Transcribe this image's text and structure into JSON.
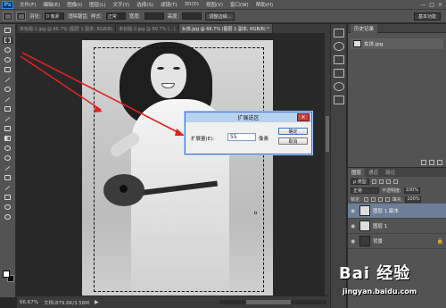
{
  "app": {
    "logo": "Ps"
  },
  "menu": [
    "文件(F)",
    "编辑(E)",
    "图像(I)",
    "图层(L)",
    "文字(Y)",
    "选择(S)",
    "滤镜(T)",
    "3D(D)",
    "视图(V)",
    "窗口(W)",
    "帮助(H)"
  ],
  "window_controls": [
    "—",
    "□",
    "×"
  ],
  "options": {
    "feather_label": "羽化:",
    "feather_value": "0 像素",
    "antialias": "消除锯齿",
    "style_label": "样式:",
    "style_value": "正常",
    "width_label": "宽度:",
    "height_label": "高度:",
    "refine_edge": "调整边缘...",
    "workspace": "基本功能"
  },
  "tabs": [
    "未标题-1.jpg @ 66.7% (图层 1 副本, RGB/8)",
    "未标题-2.jpg @ 66.7% (...)",
    "女孩.jpg @ 66.7% (图层 1 副本, RGB/8) *"
  ],
  "status": {
    "zoom": "66.67%",
    "doc": "文档:879.6K/3.58M",
    "arrow": "▶"
  },
  "dialog": {
    "title": "扩展选区",
    "label": "扩展量(E):",
    "value": "55",
    "unit": "像素",
    "ok": "确定",
    "cancel": "取消",
    "close": "✕"
  },
  "history": {
    "tab": "历史记录",
    "row_label": "女孩.jpg"
  },
  "layers": {
    "tabs": [
      "图层",
      "通道",
      "路径"
    ],
    "kind_label": "ρ 类型",
    "blend_mode": "正常",
    "opacity_label": "不透明度:",
    "opacity_value": "100%",
    "lock_label": "锁定:",
    "fill_label": "填充:",
    "fill_value": "100%",
    "items": [
      {
        "name": "图层 1 副本",
        "selected": true
      },
      {
        "name": "图层 1",
        "selected": false
      },
      {
        "name": "背景",
        "selected": false
      }
    ]
  },
  "watermark": {
    "logo": "Bai 经验",
    "url": "jingyan.baidu.com"
  },
  "colors": {
    "menu_bg": "#535353",
    "dialog_border": "#3a7bd5",
    "arrow": "#e02020",
    "selected_layer": "#6c7e98"
  }
}
